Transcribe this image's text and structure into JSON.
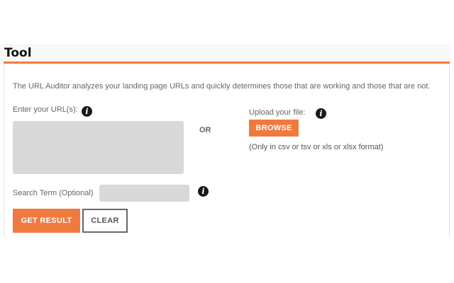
{
  "tool": {
    "title": "Tool",
    "description": "The URL Auditor analyzes your landing page URLs and quickly determines those that are working and those that are not."
  },
  "url_input": {
    "label": "Enter your URL(s):",
    "value": "",
    "info_icon": "info-icon",
    "info_glyph": "i"
  },
  "separator": {
    "text": "OR"
  },
  "upload": {
    "label": "Upload your file:",
    "info_glyph": "i",
    "browse_label": "BROWSE",
    "format_note": "(Only in csv or tsv or xls or xlsx format)"
  },
  "search_term": {
    "label": "Search Term (Optional)",
    "value": "",
    "info_glyph": "i"
  },
  "actions": {
    "get_result_label": "GET RESULT",
    "clear_label": "CLEAR"
  },
  "colors": {
    "accent": "#f07a3e",
    "input_background": "#d9d9d9",
    "text": "#666666",
    "info_icon": "#1a1a1a"
  }
}
